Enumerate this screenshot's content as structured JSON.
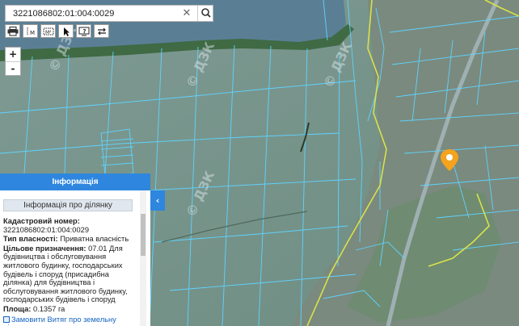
{
  "search": {
    "value": "3221086802:01:004:0029",
    "placeholder": ""
  },
  "toolbar": {
    "icons": [
      "print-icon",
      "measure-line-icon",
      "measure-area-icon",
      "pointer-icon",
      "info-icon",
      "swap-layers-icon"
    ],
    "line_label": "M",
    "area_label": "M²"
  },
  "zoom": {
    "in": "+",
    "out": "-"
  },
  "panel": {
    "title": "Інформація",
    "subtitle": "Інформація про ділянку",
    "cadastral_label": "Кадастровий номер:",
    "cadastral_value": "3221086802:01:004:0029",
    "ownership_label": "Тип власності:",
    "ownership_value": "Приватна власність",
    "purpose_label": "Цільове призначення:",
    "purpose_value": "07.01 Для будівництва і обслуговування житлового будинку, господарських будівель і споруд (присадибна ділянка) для будівництва і обслуговування житлового будинку, господарських будівель і споруд",
    "area_label": "Площа:",
    "area_value": "0.1357 га",
    "order_link": "Замовити Витяг про земельну ділянку"
  },
  "collapse_glyph": "‹",
  "watermark": "© ДЗК",
  "colors": {
    "panel_header": "#2e86de",
    "parcel_lines": "#5fd3ff",
    "boundary": "#d8e24a",
    "marker": "#f5a21c",
    "link": "#1565c0"
  }
}
